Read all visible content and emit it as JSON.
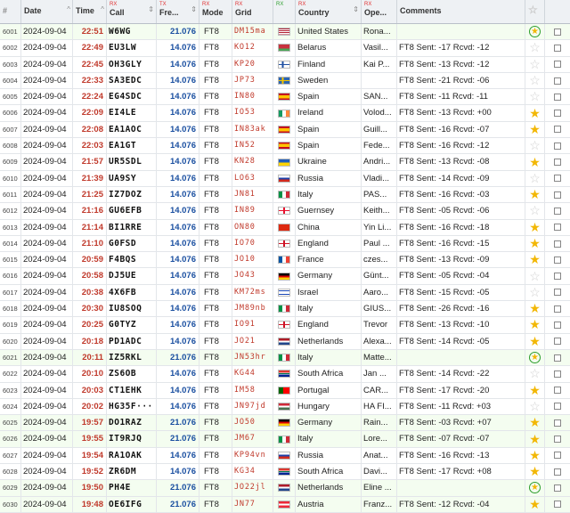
{
  "headers": {
    "num": {
      "main": "#"
    },
    "date": {
      "main": "Date"
    },
    "time": {
      "main": "Time"
    },
    "call": {
      "tag": "RX",
      "main": "Call"
    },
    "freq": {
      "tag": "TX",
      "main": "Fre..."
    },
    "mode": {
      "tag": "RX",
      "main": "Mode"
    },
    "grid": {
      "tag": "RX",
      "main": "Grid"
    },
    "flag": {
      "tag": "RX"
    },
    "country": {
      "tag": "RX",
      "main": "Country"
    },
    "operator": {
      "tag": "RX",
      "main": "Ope..."
    },
    "comments": {
      "main": "Comments"
    }
  },
  "colors": {
    "accent_red": "#c0392b",
    "freq_blue": "#1a4fa0",
    "star_gold": "#f2b705",
    "alt_row": "#f4fdf0"
  },
  "rows": [
    {
      "num": "6001",
      "date": "2024-09-04",
      "time": "22:51",
      "call": "W6WG",
      "freq": "21.076",
      "mode": "FT8",
      "grid": "DM15ma",
      "flag": "us",
      "country": "United States",
      "operator": "Rona...",
      "comments": "",
      "star": "circle",
      "alt": true
    },
    {
      "num": "6002",
      "date": "2024-09-04",
      "time": "22:49",
      "call": "EU3LW",
      "freq": "14.076",
      "mode": "FT8",
      "grid": "KO12",
      "flag": "by",
      "country": "Belarus",
      "operator": "Vasil...",
      "comments": "FT8 Sent: -17 Rcvd: -12",
      "star": "empty",
      "alt": false
    },
    {
      "num": "6003",
      "date": "2024-09-04",
      "time": "22:45",
      "call": "OH3GLY",
      "freq": "14.076",
      "mode": "FT8",
      "grid": "KP20",
      "flag": "fi",
      "country": "Finland",
      "operator": "Kai P...",
      "comments": "FT8 Sent: -13 Rcvd: -12",
      "star": "empty",
      "alt": false
    },
    {
      "num": "6004",
      "date": "2024-09-04",
      "time": "22:33",
      "call": "SA3EDC",
      "freq": "14.076",
      "mode": "FT8",
      "grid": "JP73",
      "flag": "se",
      "country": "Sweden",
      "operator": "",
      "comments": "FT8 Sent: -21 Rcvd: -06",
      "star": "empty",
      "alt": false
    },
    {
      "num": "6005",
      "date": "2024-09-04",
      "time": "22:24",
      "call": "EG4SDC",
      "freq": "14.076",
      "mode": "FT8",
      "grid": "IN80",
      "flag": "es",
      "country": "Spain",
      "operator": "SAN...",
      "comments": "FT8 Sent: -11 Rcvd: -11",
      "star": "empty",
      "alt": false
    },
    {
      "num": "6006",
      "date": "2024-09-04",
      "time": "22:09",
      "call": "EI4LE",
      "freq": "14.076",
      "mode": "FT8",
      "grid": "IO53",
      "flag": "ie",
      "country": "Ireland",
      "operator": "Volod...",
      "comments": "FT8 Sent: -13 Rcvd: +00",
      "star": "gold",
      "alt": false
    },
    {
      "num": "6007",
      "date": "2024-09-04",
      "time": "22:08",
      "call": "EA1AOC",
      "freq": "14.076",
      "mode": "FT8",
      "grid": "IN83ak",
      "flag": "es",
      "country": "Spain",
      "operator": "Guill...",
      "comments": "FT8 Sent: -16 Rcvd: -07",
      "star": "gold",
      "alt": false
    },
    {
      "num": "6008",
      "date": "2024-09-04",
      "time": "22:03",
      "call": "EA1GT",
      "freq": "14.076",
      "mode": "FT8",
      "grid": "IN52",
      "flag": "es",
      "country": "Spain",
      "operator": "Fede...",
      "comments": "FT8 Sent: -16 Rcvd: -12",
      "star": "empty",
      "alt": false
    },
    {
      "num": "6009",
      "date": "2024-09-04",
      "time": "21:57",
      "call": "UR5SDL",
      "freq": "14.076",
      "mode": "FT8",
      "grid": "KN28",
      "flag": "ua",
      "country": "Ukraine",
      "operator": "Andri...",
      "comments": "FT8 Sent: -13 Rcvd: -08",
      "star": "gold",
      "alt": false
    },
    {
      "num": "6010",
      "date": "2024-09-04",
      "time": "21:39",
      "call": "UA9SY",
      "freq": "14.076",
      "mode": "FT8",
      "grid": "LO63",
      "flag": "ru",
      "country": "Russia",
      "operator": "Vladi...",
      "comments": "FT8 Sent: -14 Rcvd: -09",
      "star": "empty",
      "alt": false
    },
    {
      "num": "6011",
      "date": "2024-09-04",
      "time": "21:25",
      "call": "IZ7DOZ",
      "freq": "14.076",
      "mode": "FT8",
      "grid": "JN81",
      "flag": "it",
      "country": "Italy",
      "operator": "PAS...",
      "comments": "FT8 Sent: -16 Rcvd: -03",
      "star": "gold",
      "alt": false
    },
    {
      "num": "6012",
      "date": "2024-09-04",
      "time": "21:16",
      "call": "GU6EFB",
      "freq": "14.076",
      "mode": "FT8",
      "grid": "IN89",
      "flag": "gg",
      "country": "Guernsey",
      "operator": "Keith...",
      "comments": "FT8 Sent: -05 Rcvd: -06",
      "star": "empty",
      "alt": false
    },
    {
      "num": "6013",
      "date": "2024-09-04",
      "time": "21:14",
      "call": "BI1RRE",
      "freq": "14.076",
      "mode": "FT8",
      "grid": "ON80",
      "flag": "cn",
      "country": "China",
      "operator": "Yin Li...",
      "comments": "FT8 Sent: -16 Rcvd: -18",
      "star": "gold",
      "alt": false
    },
    {
      "num": "6014",
      "date": "2024-09-04",
      "time": "21:10",
      "call": "G0FSD",
      "freq": "14.076",
      "mode": "FT8",
      "grid": "IO70",
      "flag": "en",
      "country": "England",
      "operator": "Paul ...",
      "comments": "FT8 Sent: -16 Rcvd: -15",
      "star": "gold",
      "alt": false
    },
    {
      "num": "6015",
      "date": "2024-09-04",
      "time": "20:59",
      "call": "F4BQS",
      "freq": "14.076",
      "mode": "FT8",
      "grid": "JO10",
      "flag": "fr",
      "country": "France",
      "operator": "czes...",
      "comments": "FT8 Sent: -13 Rcvd: -09",
      "star": "gold",
      "alt": false
    },
    {
      "num": "6016",
      "date": "2024-09-04",
      "time": "20:58",
      "call": "DJ5UE",
      "freq": "14.076",
      "mode": "FT8",
      "grid": "JO43",
      "flag": "de",
      "country": "Germany",
      "operator": "Günt...",
      "comments": "FT8 Sent: -05 Rcvd: -04",
      "star": "empty",
      "alt": false
    },
    {
      "num": "6017",
      "date": "2024-09-04",
      "time": "20:38",
      "call": "4X6FB",
      "freq": "14.076",
      "mode": "FT8",
      "grid": "KM72ms",
      "flag": "il",
      "country": "Israel",
      "operator": "Aaro...",
      "comments": "FT8 Sent: -15 Rcvd: -05",
      "star": "empty",
      "alt": false
    },
    {
      "num": "6018",
      "date": "2024-09-04",
      "time": "20:30",
      "call": "IU8SOQ",
      "freq": "14.076",
      "mode": "FT8",
      "grid": "JM89nb",
      "flag": "it",
      "country": "Italy",
      "operator": "GIUS...",
      "comments": "FT8 Sent: -26 Rcvd: -16",
      "star": "gold",
      "alt": false
    },
    {
      "num": "6019",
      "date": "2024-09-04",
      "time": "20:25",
      "call": "G0TYZ",
      "freq": "14.076",
      "mode": "FT8",
      "grid": "IO91",
      "flag": "en",
      "country": "England",
      "operator": "Trevor",
      "comments": "FT8 Sent: -13 Rcvd: -10",
      "star": "gold",
      "alt": false
    },
    {
      "num": "6020",
      "date": "2024-09-04",
      "time": "20:18",
      "call": "PD1ADC",
      "freq": "14.076",
      "mode": "FT8",
      "grid": "JO21",
      "flag": "nl",
      "country": "Netherlands",
      "operator": "Alexa...",
      "comments": "FT8 Sent: -14 Rcvd: -05",
      "star": "gold",
      "alt": false
    },
    {
      "num": "6021",
      "date": "2024-09-04",
      "time": "20:11",
      "call": "IZ5RKL",
      "freq": "21.076",
      "mode": "FT8",
      "grid": "JN53hr",
      "flag": "it",
      "country": "Italy",
      "operator": "Matte...",
      "comments": "",
      "star": "circle",
      "alt": true
    },
    {
      "num": "6022",
      "date": "2024-09-04",
      "time": "20:10",
      "call": "ZS6OB",
      "freq": "14.076",
      "mode": "FT8",
      "grid": "KG44",
      "flag": "za",
      "country": "South Africa",
      "operator": "Jan ...",
      "comments": "FT8 Sent: -14 Rcvd: -22",
      "star": "empty",
      "alt": false
    },
    {
      "num": "6023",
      "date": "2024-09-04",
      "time": "20:03",
      "call": "CT1EHK",
      "freq": "14.076",
      "mode": "FT8",
      "grid": "IM58",
      "flag": "pt",
      "country": "Portugal",
      "operator": "CAR...",
      "comments": "FT8 Sent: -17 Rcvd: -20",
      "star": "gold",
      "alt": false
    },
    {
      "num": "6024",
      "date": "2024-09-04",
      "time": "20:02",
      "call": "HG35F···",
      "freq": "14.076",
      "mode": "FT8",
      "grid": "JN97jd",
      "flag": "hu",
      "country": "Hungary",
      "operator": "HA FI...",
      "comments": "FT8 Sent: -11 Rcvd: +03",
      "star": "empty",
      "alt": false
    },
    {
      "num": "6025",
      "date": "2024-09-04",
      "time": "19:57",
      "call": "DO1RAZ",
      "freq": "21.076",
      "mode": "FT8",
      "grid": "JO50",
      "flag": "de",
      "country": "Germany",
      "operator": "Rain...",
      "comments": "FT8 Sent: -03 Rcvd: +07",
      "star": "gold",
      "alt": true
    },
    {
      "num": "6026",
      "date": "2024-09-04",
      "time": "19:55",
      "call": "IT9RJQ",
      "freq": "21.076",
      "mode": "FT8",
      "grid": "JM67",
      "flag": "it",
      "country": "Italy",
      "operator": "Lore...",
      "comments": "FT8 Sent: -07 Rcvd: -07",
      "star": "gold",
      "alt": true
    },
    {
      "num": "6027",
      "date": "2024-09-04",
      "time": "19:54",
      "call": "RA1OAK",
      "freq": "14.076",
      "mode": "FT8",
      "grid": "KP94vn",
      "flag": "ru",
      "country": "Russia",
      "operator": "Anat...",
      "comments": "FT8 Sent: -16 Rcvd: -13",
      "star": "gold",
      "alt": false
    },
    {
      "num": "6028",
      "date": "2024-09-04",
      "time": "19:52",
      "call": "ZR6DM",
      "freq": "14.076",
      "mode": "FT8",
      "grid": "KG34",
      "flag": "za",
      "country": "South Africa",
      "operator": "Davi...",
      "comments": "FT8 Sent: -17 Rcvd: +08",
      "star": "gold",
      "alt": false
    },
    {
      "num": "6029",
      "date": "2024-09-04",
      "time": "19:50",
      "call": "PH4E",
      "freq": "21.076",
      "mode": "FT8",
      "grid": "JO22jl",
      "flag": "nl",
      "country": "Netherlands",
      "operator": "Eline ...",
      "comments": "",
      "star": "circle",
      "alt": true
    },
    {
      "num": "6030",
      "date": "2024-09-04",
      "time": "19:48",
      "call": "OE6IFG",
      "freq": "21.076",
      "mode": "FT8",
      "grid": "JN77",
      "flag": "at",
      "country": "Austria",
      "operator": "Franz...",
      "comments": "FT8 Sent: -12 Rcvd: -04",
      "star": "gold",
      "alt": true
    }
  ]
}
